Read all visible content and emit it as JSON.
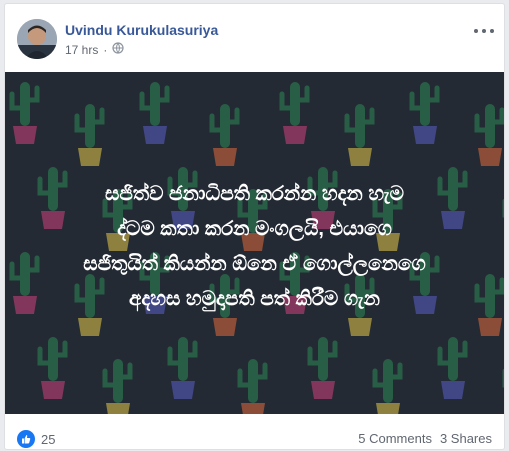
{
  "post": {
    "author": "Uvindu Kurukulasuriya",
    "timestamp": "17 hrs",
    "privacy_icon": "globe-icon",
    "more_icon": "more-options-icon"
  },
  "media": {
    "background": "#232a34",
    "lines": [
      "සජිත්ව ජනාධිපති කරන්න හදන හැම",
      "ද්ටම කතා කරන මංගලයි, එයාගෙ",
      "සජිතුයිත් කියන්න ඕනෙ ඒ ගොල්ලනෙගෙ",
      "අදහස හමුදාපති පත් කිරීම ගැන"
    ]
  },
  "footer": {
    "reaction_icon": "like-icon",
    "reaction_count": "25",
    "comments": "5 Comments",
    "shares": "3 Shares"
  },
  "colors": {
    "link": "#385898",
    "like": "#1877f2",
    "cactus": "#2e8a55",
    "pots": [
      "#d3407d",
      "#e6c84a",
      "#5a5fc6",
      "#e06a3a"
    ]
  }
}
